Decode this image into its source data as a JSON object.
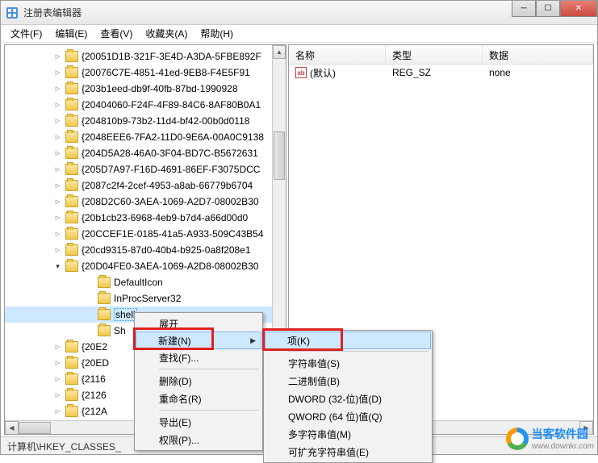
{
  "window": {
    "title": "注册表编辑器"
  },
  "menubar": [
    "文件(F)",
    "编辑(E)",
    "查看(V)",
    "收藏夹(A)",
    "帮助(H)"
  ],
  "tree": {
    "items": [
      {
        "k": "{20051D1B-321F-3E4D-A3DA-5FBE892F"
      },
      {
        "k": "{20076C7E-4851-41ed-9EB8-F4E5F91"
      },
      {
        "k": "{203b1eed-db9f-40fb-87bd-1990928"
      },
      {
        "k": "{20404060-F24F-4F89-84C6-8AF80B0A1"
      },
      {
        "k": "{204810b9-73b2-11d4-bf42-00b0d0118"
      },
      {
        "k": "{2048EEE6-7FA2-11D0-9E6A-00A0C9138"
      },
      {
        "k": "{204D5A28-46A0-3F04-BD7C-B5672631"
      },
      {
        "k": "{205D7A97-F16D-4691-86EF-F3075DCC"
      },
      {
        "k": "{2087c2f4-2cef-4953-a8ab-66779b6704"
      },
      {
        "k": "{208D2C60-3AEA-1069-A2D7-08002B30"
      },
      {
        "k": "{20b1cb23-6968-4eb9-b7d4-a66d00d0"
      },
      {
        "k": "{20CCEF1E-0185-41a5-A933-509C43B54"
      },
      {
        "k": "{20cd9315-87d0-40b4-b925-0a8f208e1"
      },
      {
        "k": "{20D04FE0-3AEA-1069-A2D8-08002B30",
        "expanded": true
      }
    ],
    "children": [
      {
        "k": "DefaultIcon"
      },
      {
        "k": "InProcServer32"
      },
      {
        "k": "shell",
        "selected": true
      },
      {
        "k": "Sh"
      }
    ],
    "after": [
      {
        "k": "{20E2"
      },
      {
        "k": "{20ED"
      },
      {
        "k": "{2116"
      },
      {
        "k": "{2126"
      },
      {
        "k": "{212A"
      }
    ]
  },
  "list": {
    "columns": {
      "name": "名称",
      "type": "类型",
      "data": "数据"
    },
    "rows": [
      {
        "name": "(默认)",
        "type": "REG_SZ",
        "data": "none"
      }
    ]
  },
  "context1": {
    "expand": "展开",
    "new": "新建(N)",
    "find": "查找(F)...",
    "delete": "删除(D)",
    "rename": "重命名(R)",
    "export": "导出(E)",
    "permissions": "权限(P)..."
  },
  "context2": {
    "key": "项(K)",
    "string": "字符串值(S)",
    "binary": "二进制值(B)",
    "dword": "DWORD (32-位)值(D)",
    "qword": "QWORD (64 位)值(Q)",
    "multistring": "多字符串值(M)",
    "expandstring": "可扩充字符串值(E)"
  },
  "statusbar": "计算机\\HKEY_CLASSES_",
  "watermark": {
    "cn": "当客软件园",
    "url": "www.downkr.com"
  }
}
